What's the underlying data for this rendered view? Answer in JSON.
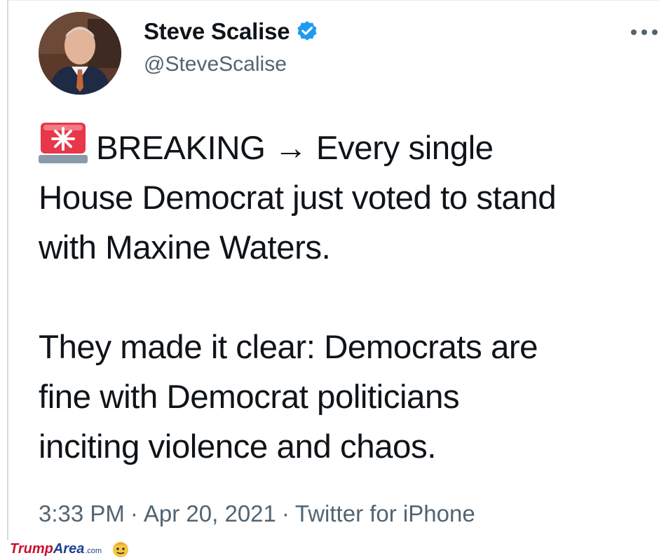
{
  "tweet": {
    "author": {
      "display_name": "Steve Scalise",
      "handle": "@SteveScalise",
      "verified": true
    },
    "icons": {
      "avatar": "profile-photo",
      "verified": "verified-badge-icon",
      "more": "more-options-icon",
      "siren": "rotating-light-emoji"
    },
    "body": {
      "line1": "BREAKING → Every single",
      "line2": "House Democrat just voted to stand",
      "line3": "with Maxine Waters.",
      "line4": "They made it clear: Democrats are",
      "line5": "fine with Democrat politicians",
      "line6": "inciting violence and chaos."
    },
    "meta": {
      "time": "3:33 PM",
      "date": "Apr 20, 2021",
      "source": "Twitter for iPhone",
      "separator": "·"
    }
  },
  "watermark": {
    "brand_part1": "Trump",
    "brand_part2": "Area",
    "brand_suffix": ".com"
  },
  "colors": {
    "text": "#0f1419",
    "secondary_text": "#536471",
    "verified_blue": "#1d9bf0",
    "siren_red": "#e8364a",
    "watermark_red": "#c8102e",
    "watermark_blue": "#1c3f94"
  }
}
